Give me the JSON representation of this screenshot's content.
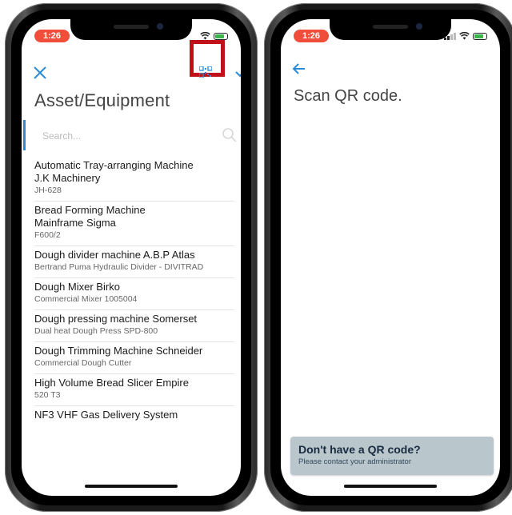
{
  "status_bar": {
    "left_time": "1:26",
    "right_time": "1:26"
  },
  "left_screen": {
    "title": "Asset/Equipment",
    "search": {
      "placeholder": "Search..."
    },
    "icons": {
      "close": "close-icon",
      "qr": "qr-code-icon",
      "confirm": "checkmark-icon",
      "search": "search-icon"
    },
    "highlight_color": "#c0111b",
    "accent_color": "#2d8ad6",
    "assets": [
      {
        "name": "Automatic Tray-arranging Machine",
        "manufacturer": "J.K Machinery",
        "code": "JH-628"
      },
      {
        "name": "Bread Forming Machine",
        "manufacturer": "Mainframe Sigma",
        "code": "F600/2"
      },
      {
        "name": "Dough divider machine A.B.P Atlas",
        "manufacturer": "",
        "code": "Bertrand Puma Hydraulic Divider -  DIVITRAD"
      },
      {
        "name": "Dough Mixer Birko",
        "manufacturer": "",
        "code": "Commercial Mixer 1005004"
      },
      {
        "name": "Dough pressing machine Somerset",
        "manufacturer": "",
        "code": "Dual heat Dough Press SPD-800"
      },
      {
        "name": "Dough Trimming Machine Schneider",
        "manufacturer": "",
        "code": "Commercial Dough Cutter"
      },
      {
        "name": "High Volume Bread Slicer Empire",
        "manufacturer": "",
        "code": "520 T3"
      },
      {
        "name": "NF3 VHF  Gas Delivery System",
        "manufacturer": "",
        "code": ""
      }
    ]
  },
  "right_screen": {
    "title": "Scan QR code.",
    "icons": {
      "back": "back-arrow-icon"
    },
    "card": {
      "title": "Don't have a QR code?",
      "subtitle": "Please contact your administrator",
      "background": "#b9c7cd"
    }
  }
}
